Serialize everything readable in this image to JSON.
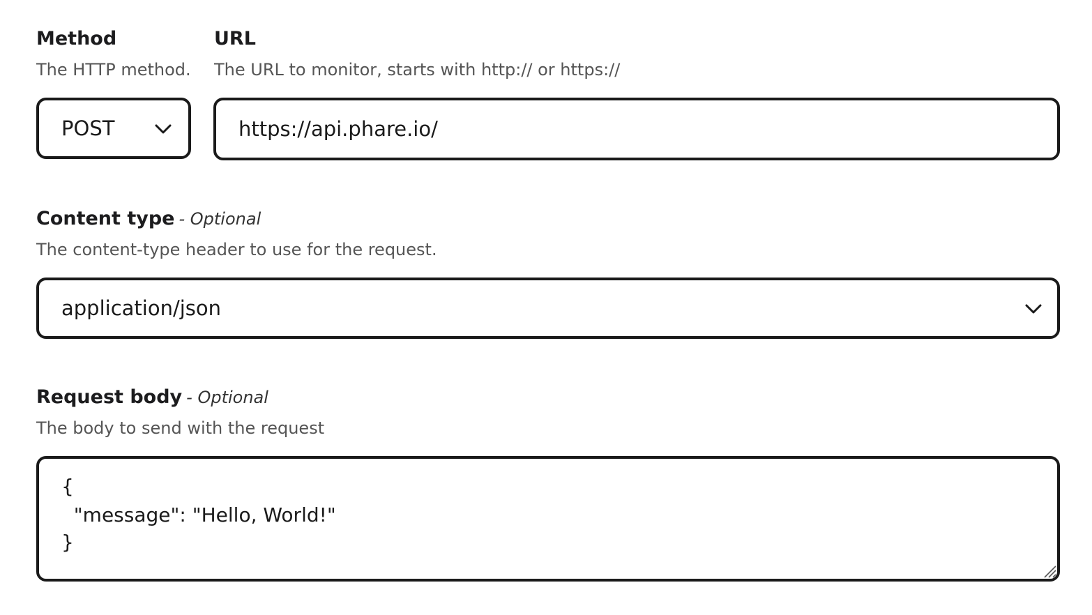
{
  "method": {
    "label": "Method",
    "help": "The HTTP method.",
    "value": "POST",
    "chevron_icon": "chevron-down-icon"
  },
  "url": {
    "label": "URL",
    "help": "The URL to monitor, starts with http:// or https://",
    "value": "https://api.phare.io/"
  },
  "content_type": {
    "label": "Content type",
    "optional": "- Optional",
    "help": "The content-type header to use for the request.",
    "value": "application/json",
    "chevron_icon": "chevron-down-icon"
  },
  "request_body": {
    "label": "Request body",
    "optional": "- Optional",
    "help": "The body to send with the request",
    "lines": [
      "{",
      "  \"message\": \"Hello, World!\"",
      "}"
    ],
    "resize_icon": "resize-grip-icon"
  }
}
